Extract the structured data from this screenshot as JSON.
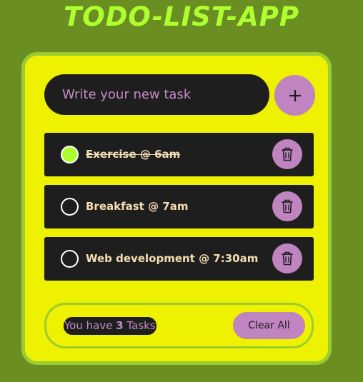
{
  "app": {
    "title": "TODO-LIST-APP"
  },
  "input": {
    "value": "",
    "placeholder": "Write your new task"
  },
  "add_button": {
    "label": "+",
    "icon": "plus-icon"
  },
  "tasks": [
    {
      "text": "Exercise @ 6am",
      "completed": true
    },
    {
      "text": "Breakfast @ 7am",
      "completed": false
    },
    {
      "text": "Web development @ 7:30am",
      "completed": false
    }
  ],
  "delete_icon": "trash-icon",
  "footer": {
    "count_prefix": "You have ",
    "count": "3",
    "count_suffix": " Tasks",
    "clear_label": "Clear All"
  },
  "colors": {
    "page_background": "#6b8e23",
    "title": "#adff2f",
    "card_background": "#eef100",
    "card_border": "#9acd32",
    "dark": "#1e1e1e",
    "accent": "#c084c0",
    "check_done": "#adff2f",
    "task_text": "#f5deb3"
  }
}
